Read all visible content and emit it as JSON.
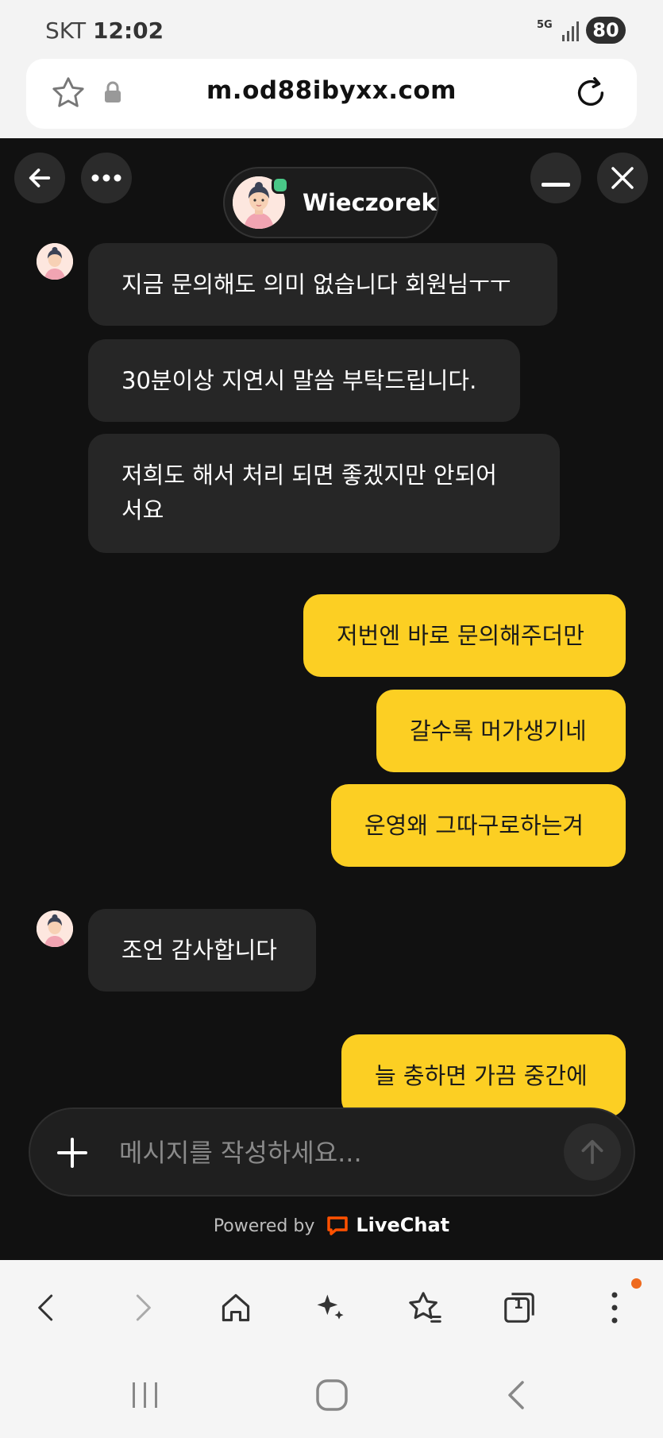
{
  "status_bar": {
    "carrier": "SKT",
    "time": "12:02",
    "network": "5G",
    "battery": "80"
  },
  "browser": {
    "url": "m.od88ibyxx.com"
  },
  "chat": {
    "agent_name": "Wieczorek",
    "messages": [
      {
        "from": "agent",
        "text": "지금 문의해도 의미 없습니다 회원님ㅜㅜ"
      },
      {
        "from": "agent",
        "text": "30분이상 지연시 말씀 부탁드립니다."
      },
      {
        "from": "agent",
        "text": "저희도 해서 처리 되면 좋겠지만 안되어",
        "text2": "서요"
      },
      {
        "from": "user",
        "text": "저번엔 바로 문의해주더만"
      },
      {
        "from": "user",
        "text": "갈수록 머가생기네"
      },
      {
        "from": "user",
        "text": "운영왜 그따구로하는겨"
      },
      {
        "from": "agent",
        "text": "조언 감사합니다"
      },
      {
        "from": "user",
        "text": "늘 충하면 가끔 중간에"
      }
    ],
    "composer_placeholder": "메시지를 작성하세요...",
    "powered_by": "Powered by",
    "brand": "LiveChat"
  },
  "colors": {
    "user_bubble": "#fccf23",
    "agent_bubble": "#262626",
    "chat_bg": "#111111",
    "online": "#49c887",
    "brand": "#ff5100"
  },
  "icons": [
    "star-icon",
    "lock-icon",
    "reload-icon",
    "back-arrow-icon",
    "more-icon",
    "minimize-icon",
    "close-icon",
    "plus-icon",
    "send-arrow-icon",
    "nav-back-icon",
    "nav-forward-icon",
    "home-icon",
    "sparkle-icon",
    "bookmarks-icon",
    "tabs-icon",
    "menu-dots-icon"
  ],
  "browser_nav": {
    "tab_count": "1"
  }
}
